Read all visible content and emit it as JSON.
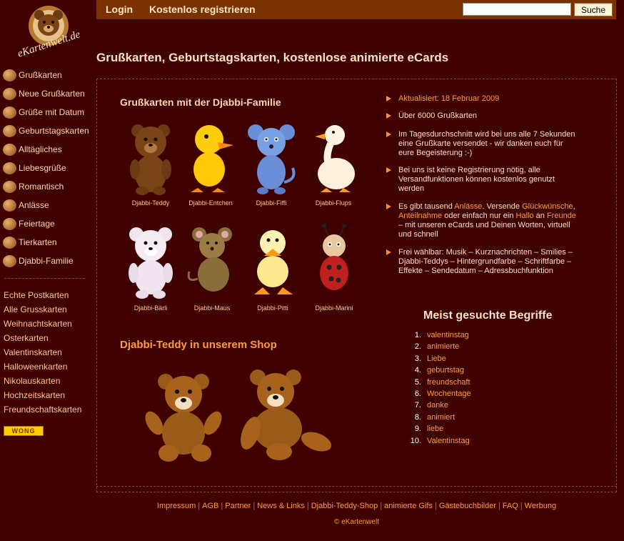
{
  "header": {
    "nav": [
      "Login",
      "Kostenlos registrieren"
    ],
    "search_placeholder": "",
    "search_button": "Suche"
  },
  "logo": {
    "text": "eKartenwelt.de"
  },
  "sidebar": {
    "categories": [
      {
        "label": "Grußkarten",
        "icon": "house-icon"
      },
      {
        "label": "Neue Grußkarten",
        "icon": "new-card-icon"
      },
      {
        "label": "Grüße mit Datum",
        "icon": "calendar-icon"
      },
      {
        "label": "Geburtstagskarten",
        "icon": "birthday-cake-icon"
      },
      {
        "label": "Alltägliches",
        "icon": "smiley-icon"
      },
      {
        "label": "Liebesgrüße",
        "icon": "heart-icon"
      },
      {
        "label": "Romantisch",
        "icon": "rose-icon"
      },
      {
        "label": "Anlässe",
        "icon": "gift-icon"
      },
      {
        "label": "Feiertage",
        "icon": "santa-hat-icon"
      },
      {
        "label": "Tierkarten",
        "icon": "animal-icon"
      },
      {
        "label": "Djabbi-Familie",
        "icon": "duck-icon"
      }
    ],
    "links": [
      "Echte Postkarten",
      "Alle Grusskarten",
      "Weihnachtskarten",
      "Osterkarten",
      "Valentinskarten",
      "Halloweenkarten",
      "Nikolauskarten",
      "Hochzeitskarten",
      "Freundschaftskarten"
    ],
    "badge": "WONG"
  },
  "main": {
    "title": "Grußkarten, Geburtstagskarten, kostenlose animierte eCards",
    "family_title": "Grußkarten mit der Djabbi-Familie",
    "figures": [
      "Djabbi-Teddy",
      "Djabbi-Entchen",
      "Djabbi-Fiffi",
      "Djabbi-Flups",
      "Djabbi-Bärli",
      "Djabbi-Maus",
      "Djabbi-Pitti",
      "Djabbi-Marini"
    ],
    "shop_title": "Djabbi-Teddy in unserem Shop",
    "updated": "Aktualisiert: 18 Februar 2009",
    "bullets": {
      "count": "Über 6000 Grußkarten",
      "stats": "Im Tagesdurchschnitt wird bei uns alle 7 Sekunden eine Grußkarte versendet - wir danken euch für eure Begeisterung :-)",
      "noreg": "Bei uns ist keine Registrierung nötig, alle Versandfunktionen können kostenlos genutzt werden",
      "occ_1": "Es gibt tausend ",
      "occ_link1": "Anlässe",
      "occ_2": ". Versende ",
      "occ_link2": "Glückwünsche",
      "occ_3": ", ",
      "occ_link3": "Anteilnahme",
      "occ_4": " oder einfach nur ein ",
      "occ_link4": "Hallo",
      "occ_5": " an ",
      "occ_link5": "Freunde",
      "occ_6": " – mit unseren eCards und Deinen Worten, virtuell und schnell",
      "features": "Frei wählbar: Musik – Kurznachrichten – Smilies – Djabbi-Teddys – Hintergrundfarbe – Schriftfarbe – Effekte – Sendedatum – Adressbuchfunktion"
    },
    "popular_title": "Meist gesuchte Begriffe",
    "popular": [
      "valentinstag",
      "animierte",
      "Liebe",
      "geburtstag",
      "freundschaft",
      "Wochentage",
      "danke",
      "animiert",
      "liebe",
      "Valentinstag"
    ]
  },
  "footer": {
    "links": [
      "Impressum",
      "AGB",
      "Partner",
      "News & Links",
      "Djabbi-Teddy-Shop",
      "animierte Gifs",
      "Gästebuchbilder",
      "FAQ",
      "Werbung"
    ],
    "copyright": "© eKartenwelt"
  }
}
